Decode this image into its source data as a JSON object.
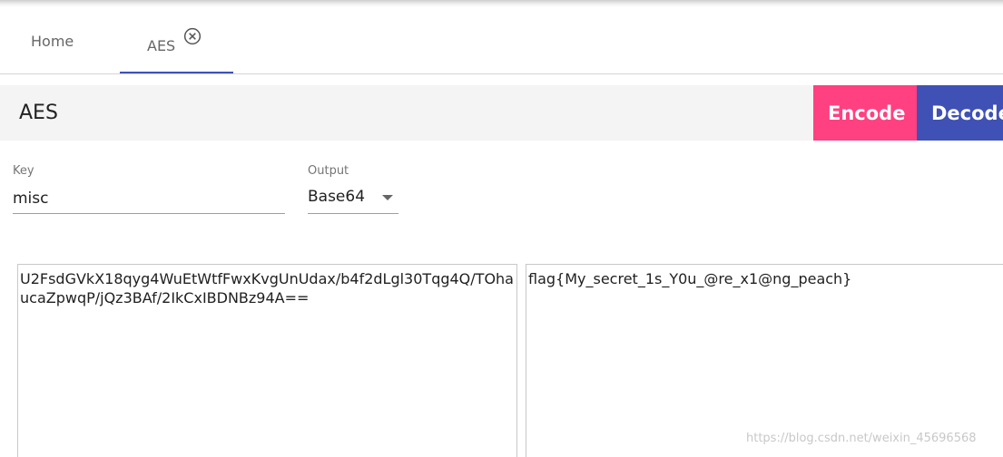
{
  "tabs": {
    "home_label": "Home",
    "aes_label": "AES"
  },
  "header": {
    "title": "AES",
    "encode_label": "Encode",
    "decode_label": "Decode"
  },
  "form": {
    "key_label": "Key",
    "key_value": "misc",
    "output_label": "Output",
    "output_value": "Base64"
  },
  "input_text": "U2FsdGVkX18qyg4WuEtWtfFwxKvgUnUdax/b4f2dLgl30Tqg4Q/TOhaucaZpwqP/jQz3BAf/2IkCxIBDNBz94A==",
  "output_text": "flag{My_secret_1s_Y0u_@re_x1@ng_peach}",
  "watermark": "https://blog.csdn.net/weixin_45696568",
  "colors": {
    "encode": "#ff4081",
    "decode": "#3f51b5",
    "tab_underline": "#3f51b5"
  },
  "icons": {
    "tab_close": "close-circle-icon",
    "dropdown": "chevron-down-icon"
  }
}
